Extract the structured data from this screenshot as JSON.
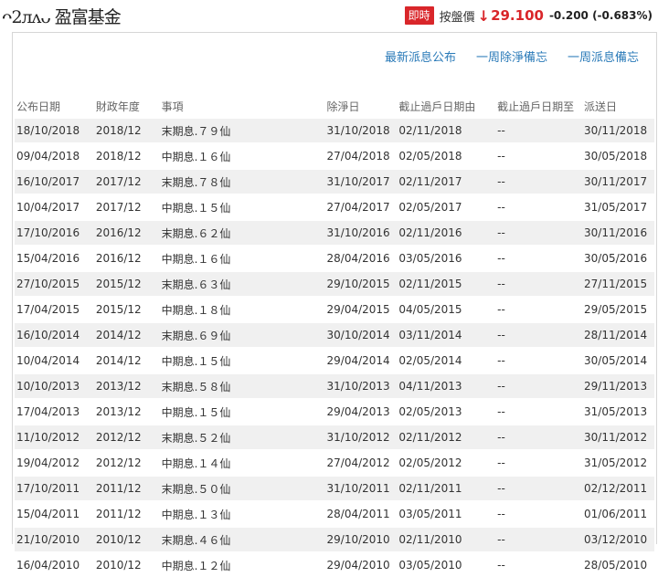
{
  "header": {
    "title": "ᴖ2ᴫᴧᴗ 盈富基金",
    "live_badge": "即時",
    "price_label": "按盤價",
    "arrow": "↓",
    "price": "29.100",
    "change": "-0.200 (-0.683%)"
  },
  "links": [
    "最新派息公布",
    "一周除淨備忘",
    "一周派息備忘"
  ],
  "table": {
    "columns": [
      "公布日期",
      "財政年度",
      "事項",
      "除淨日",
      "截止過戶日期由",
      "截止過戶日期至",
      "派送日"
    ],
    "rows": [
      [
        "18/10/2018",
        "2018/12",
        "末期息.７９仙",
        "31/10/2018",
        "02/11/2018",
        "--",
        "30/11/2018"
      ],
      [
        "09/04/2018",
        "2018/12",
        "中期息.１６仙",
        "27/04/2018",
        "02/05/2018",
        "--",
        "30/05/2018"
      ],
      [
        "16/10/2017",
        "2017/12",
        "末期息.７８仙",
        "31/10/2017",
        "02/11/2017",
        "--",
        "30/11/2017"
      ],
      [
        "10/04/2017",
        "2017/12",
        "中期息.１５仙",
        "27/04/2017",
        "02/05/2017",
        "--",
        "31/05/2017"
      ],
      [
        "17/10/2016",
        "2016/12",
        "末期息.６２仙",
        "31/10/2016",
        "02/11/2016",
        "--",
        "30/11/2016"
      ],
      [
        "15/04/2016",
        "2016/12",
        "中期息.１６仙",
        "28/04/2016",
        "03/05/2016",
        "--",
        "30/05/2016"
      ],
      [
        "27/10/2015",
        "2015/12",
        "末期息.６３仙",
        "29/10/2015",
        "02/11/2015",
        "--",
        "27/11/2015"
      ],
      [
        "17/04/2015",
        "2015/12",
        "中期息.１８仙",
        "29/04/2015",
        "04/05/2015",
        "--",
        "29/05/2015"
      ],
      [
        "16/10/2014",
        "2014/12",
        "末期息.６９仙",
        "30/10/2014",
        "03/11/2014",
        "--",
        "28/11/2014"
      ],
      [
        "10/04/2014",
        "2014/12",
        "中期息.１５仙",
        "29/04/2014",
        "02/05/2014",
        "--",
        "30/05/2014"
      ],
      [
        "10/10/2013",
        "2013/12",
        "末期息.５８仙",
        "31/10/2013",
        "04/11/2013",
        "--",
        "29/11/2013"
      ],
      [
        "17/04/2013",
        "2013/12",
        "中期息.１５仙",
        "29/04/2013",
        "02/05/2013",
        "--",
        "31/05/2013"
      ],
      [
        "11/10/2012",
        "2012/12",
        "末期息.５２仙",
        "31/10/2012",
        "02/11/2012",
        "--",
        "30/11/2012"
      ],
      [
        "19/04/2012",
        "2012/12",
        "中期息.１４仙",
        "27/04/2012",
        "02/05/2012",
        "--",
        "31/05/2012"
      ],
      [
        "17/10/2011",
        "2011/12",
        "末期息.５０仙",
        "31/10/2011",
        "02/11/2011",
        "--",
        "02/12/2011"
      ],
      [
        "15/04/2011",
        "2011/12",
        "中期息.１３仙",
        "28/04/2011",
        "03/05/2011",
        "--",
        "01/06/2011"
      ],
      [
        "21/10/2010",
        "2010/12",
        "末期息.４６仙",
        "29/10/2010",
        "02/11/2010",
        "--",
        "03/12/2010"
      ],
      [
        "16/04/2010",
        "2010/12",
        "中期息.１２仙",
        "29/04/2010",
        "03/05/2010",
        "--",
        "28/05/2010"
      ]
    ]
  },
  "colors": {
    "accent_red": "#d9262a",
    "link_blue": "#2a7ab8",
    "row_stripe": "#f0f0f0"
  }
}
